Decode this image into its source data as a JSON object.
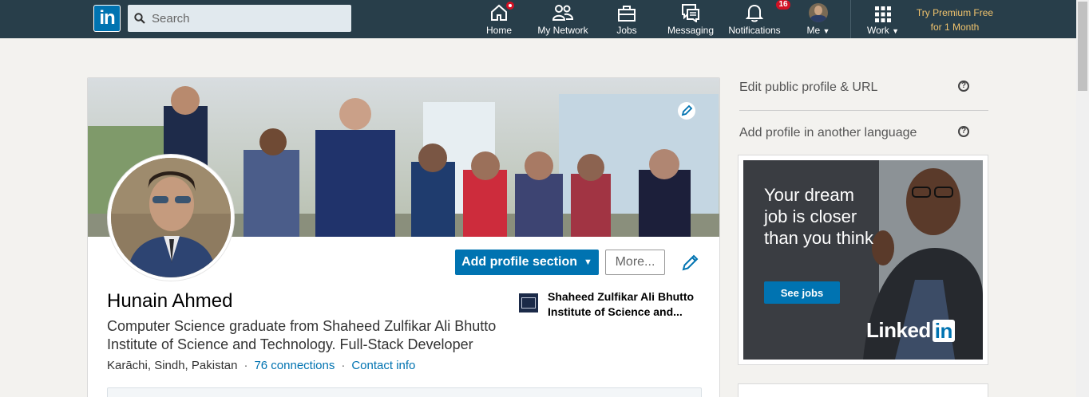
{
  "nav": {
    "logo_text": "in",
    "search_placeholder": "Search",
    "items": [
      {
        "label": "Home",
        "icon": "home-icon"
      },
      {
        "label": "My Network",
        "icon": "network-icon"
      },
      {
        "label": "Jobs",
        "icon": "briefcase-icon"
      },
      {
        "label": "Messaging",
        "icon": "messaging-icon"
      },
      {
        "label": "Notifications",
        "icon": "bell-icon",
        "badge": "16"
      },
      {
        "label": "Me",
        "icon": "avatar-icon"
      },
      {
        "label": "Work",
        "icon": "grid-icon"
      }
    ],
    "premium_line1": "Try Premium Free",
    "premium_line2": "for 1 Month"
  },
  "profile": {
    "name": "Hunain Ahmed",
    "headline": "Computer Science graduate from Shaheed Zulfikar Ali Bhutto Institute of Science and Technology. Full-Stack Developer",
    "location": "Karāchi, Sindh, Pakistan",
    "connections": "76 connections",
    "contact": "Contact info",
    "add_section_label": "Add profile section",
    "more_label": "More...",
    "school_line1": "Shaheed Zulfikar Ali Bhutto",
    "school_line2": "Institute of Science and..."
  },
  "sidebar": {
    "edit_public": "Edit public profile & URL",
    "add_language": "Add profile in another language"
  },
  "ad": {
    "text": "Your dream job is closer than you think",
    "button": "See jobs",
    "brand": "Linked",
    "brand_in": "in"
  },
  "colors": {
    "nav_bg": "#283e4a",
    "brand_blue": "#0073b1",
    "premium_gold": "#f2c46d",
    "badge_red": "#d11124"
  }
}
